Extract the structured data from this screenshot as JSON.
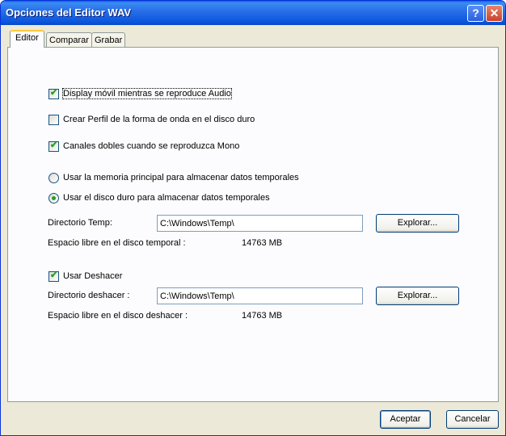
{
  "window": {
    "title": "Opciones del Editor WAV"
  },
  "tabs": [
    {
      "label": "Editor",
      "active": true
    },
    {
      "label": "Comparar",
      "active": false
    },
    {
      "label": "Grabar",
      "active": false
    }
  ],
  "options": {
    "display_movil": {
      "label": "Display móvil mientras se reproduce Audio",
      "checked": true
    },
    "crear_perfil": {
      "label": "Crear Perfil de la forma de onda en el disco duro",
      "checked": false
    },
    "canales_dobles": {
      "label": "Canales dobles cuando se reproduzca Mono",
      "checked": true
    }
  },
  "storage": {
    "memoria": {
      "label": "Usar la memoria principal para almacenar datos temporales",
      "selected": false
    },
    "disco": {
      "label": "Usar el disco duro para almacenar datos temporales",
      "selected": true
    }
  },
  "temp": {
    "dir_label": "Directorio Temp:",
    "dir_value": "C:\\Windows\\Temp\\",
    "browse_label": "Explorar...",
    "free_label": "Espacio libre en el disco temporal :",
    "free_value": "14763 MB"
  },
  "undo": {
    "checkbox_label": "Usar Deshacer",
    "checked": true,
    "dir_label": "Directorio deshacer :",
    "dir_value": "C:\\Windows\\Temp\\",
    "browse_label": "Explorar...",
    "free_label": "Espacio libre en el disco deshacer :",
    "free_value": "14763 MB"
  },
  "footer": {
    "ok_label": "Aceptar",
    "cancel_label": "Cancelar"
  }
}
